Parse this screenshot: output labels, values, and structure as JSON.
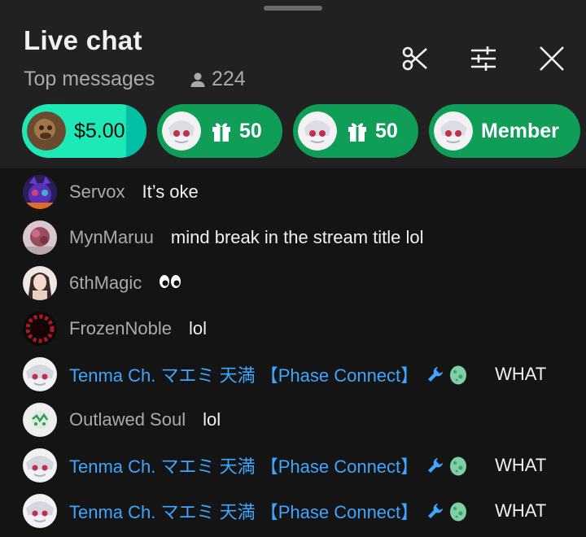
{
  "header": {
    "title": "Live chat",
    "subtitle": "Top messages",
    "viewer_count": "224"
  },
  "tickers": [
    {
      "label": "$5.00",
      "kind": "superchat",
      "color_main": "#1de9b6",
      "color_dark": "#00bfa5",
      "avatar_color": "#7a5a3a"
    },
    {
      "label": "50",
      "kind": "gift",
      "color_main": "#15a155",
      "color_dark": "#0f9d58"
    },
    {
      "label": "50",
      "kind": "gift",
      "color_main": "#15a155",
      "color_dark": "#0f9d58"
    },
    {
      "label": "Member",
      "kind": "member",
      "color_main": "#15a155",
      "color_dark": "#0f9d58"
    }
  ],
  "messages": [
    {
      "author": "Servox",
      "text": "It’s oke",
      "owner": false,
      "avatar": "cat"
    },
    {
      "author": "MynMaruu",
      "text": "mind break in the stream title lol",
      "owner": false,
      "avatar": "flower"
    },
    {
      "author": "6thMagic",
      "text": "",
      "emoji": "eyes",
      "owner": false,
      "avatar": "anime"
    },
    {
      "author": "FrozenNoble",
      "text": "lol",
      "owner": false,
      "avatar": "ring"
    },
    {
      "author": "Tenma Ch. マエミ 天満 【Phase Connect】",
      "text": "WHAT",
      "owner": true,
      "avatar": "tenma"
    },
    {
      "author": "Outlawed Soul",
      "text": "lol",
      "owner": false,
      "avatar": "soul"
    },
    {
      "author": "Tenma Ch. マエミ 天満 【Phase Connect】",
      "text": "WHAT",
      "owner": true,
      "avatar": "tenma"
    },
    {
      "author": "Tenma Ch. マエミ 天満 【Phase Connect】",
      "text": "WHAT",
      "owner": true,
      "avatar": "tenma"
    }
  ],
  "colors": {
    "owner_name": "#3ea6ff",
    "author_name": "#aaaaaa",
    "message_text": "#f1f1f1",
    "header_bg": "#212121",
    "chat_bg": "#141414"
  }
}
